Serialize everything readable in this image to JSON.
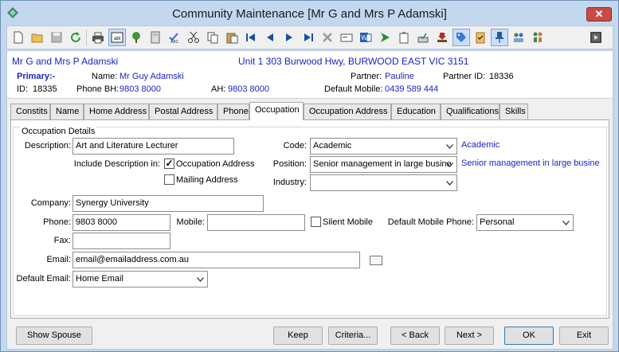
{
  "window": {
    "title": "Community Maintenance  [Mr G and Mrs P Adamski]",
    "close_symbol": "✕"
  },
  "toolbar": {
    "icons": [
      "new-icon",
      "open-icon",
      "save-icon",
      "refresh-icon",
      "print-icon",
      "abl-icon",
      "tree-icon",
      "calculator-icon",
      "spellcheck-icon",
      "cut-icon",
      "copy-icon",
      "paste-icon",
      "first-record-icon",
      "previous-record-icon",
      "next-record-icon",
      "last-record-icon",
      "delete-icon",
      "card-icon",
      "word-icon",
      "run-icon",
      "clipboard-icon",
      "inbox-icon",
      "download-icon",
      "tag-icon",
      "checklist-icon",
      "pin-icon",
      "group-icon",
      "people-icon",
      "exit-icon"
    ],
    "abl_text": "abl"
  },
  "header": {
    "name": "Mr G and Mrs P Adamski",
    "address": "Unit 1 303 Burwood Hwy, BURWOOD EAST VIC 3151",
    "primary_label": "Primary:-",
    "name_label": "Name:",
    "name_value": "Mr Guy Adamski",
    "partner_label": "Partner:",
    "partner_value": "Pauline",
    "partner_id_label": "Partner ID:",
    "partner_id_value": "18336",
    "id_label": "ID:",
    "id_value": "18335",
    "phone_bh_label": "Phone BH:",
    "phone_bh_value": "9803 8000",
    "ah_label": "AH:",
    "ah_value": "9803 8000",
    "mobile_label": "Default Mobile:",
    "mobile_value": "0439 589 444"
  },
  "tabs": [
    "Constits",
    "Name",
    "Home Address",
    "Postal Address",
    "Phone",
    "Occupation",
    "Occupation Address",
    "Education",
    "Qualifications",
    "Skills"
  ],
  "active_tab": "Occupation",
  "occupation": {
    "group_title": "Occupation Details",
    "description_label": "Description:",
    "description_value": "Art and Literature Lecturer",
    "include_label": "Include Description in:",
    "occ_address_label": "Occupation Address",
    "occ_address_checked": true,
    "mailing_address_label": "Mailing Address",
    "mailing_address_checked": false,
    "code_label": "Code:",
    "code_value": "Academic",
    "code_display": "Academic",
    "position_label": "Position:",
    "position_value": "Senior management in large busine",
    "position_display": "Senior management in large busine",
    "industry_label": "Industry:",
    "industry_value": "",
    "company_label": "Company:",
    "company_value": "Synergy University",
    "phone_label": "Phone:",
    "phone_value": "9803 8000",
    "mobile_label": "Mobile:",
    "mobile_value": "",
    "silent_mobile_label": "Silent Mobile",
    "silent_mobile_checked": false,
    "default_mobile_phone_label": "Default Mobile Phone:",
    "default_mobile_phone_value": "Personal",
    "fax_label": "Fax:",
    "fax_value": "",
    "email_label": "Email:",
    "email_value": "email@emailaddress.com.au",
    "default_email_label": "Default Email:",
    "default_email_value": "Home Email",
    "check_mark": "✓"
  },
  "buttons": {
    "show_spouse": "Show Spouse",
    "keep": "Keep",
    "criteria": "Criteria...",
    "back": "< Back",
    "next": "Next >",
    "ok": "OK",
    "exit": "Exit"
  }
}
